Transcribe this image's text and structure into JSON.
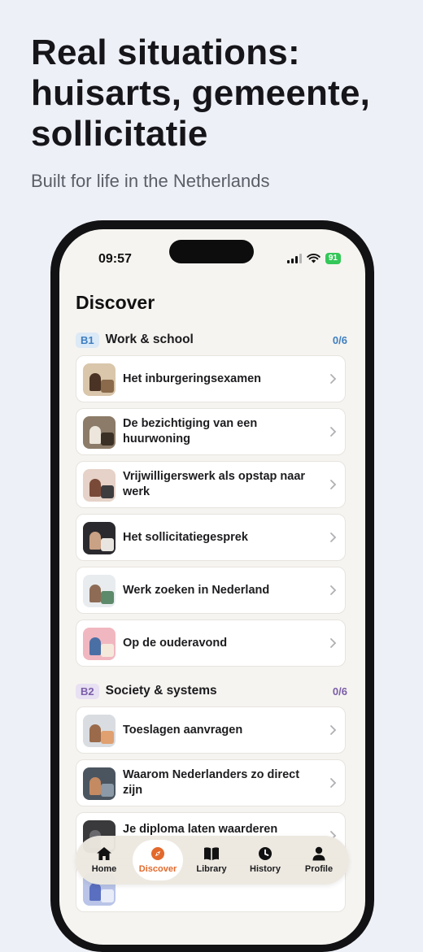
{
  "promo": {
    "headline_lines": [
      "Real situations:",
      "huisarts, gemeente,",
      "sollicitatie"
    ],
    "subheadline": "Built for life in the Netherlands"
  },
  "status_bar": {
    "time": "09:57",
    "battery": "91"
  },
  "page_title": "Discover",
  "sections": [
    {
      "level": "B1",
      "title": "Work & school",
      "progress": "0/6",
      "accent": "#3e7fc1",
      "badge_bg": "#dce9f6",
      "items": [
        "Het inburgeringsexamen",
        "De bezichtiging van een huurwoning",
        "Vrijwilligerswerk als opstap naar werk",
        "Het sollicitatiegesprek",
        "Werk zoeken in Nederland",
        "Op de ouderavond"
      ]
    },
    {
      "level": "B2",
      "title": "Society & systems",
      "progress": "0/6",
      "accent": "#7a5ea8",
      "badge_bg": "#e8e0f3",
      "items": [
        "Toeslagen aanvragen",
        "Waarom Nederlanders zo direct zijn",
        "Je diploma laten waarderen"
      ]
    }
  ],
  "tab_bar": {
    "active": "Discover",
    "active_color": "#e2692c",
    "tabs": [
      {
        "label": "Home",
        "icon": "home-icon"
      },
      {
        "label": "Discover",
        "icon": "compass-icon"
      },
      {
        "label": "Library",
        "icon": "book-icon"
      },
      {
        "label": "History",
        "icon": "clock-icon"
      },
      {
        "label": "Profile",
        "icon": "person-icon"
      }
    ]
  }
}
